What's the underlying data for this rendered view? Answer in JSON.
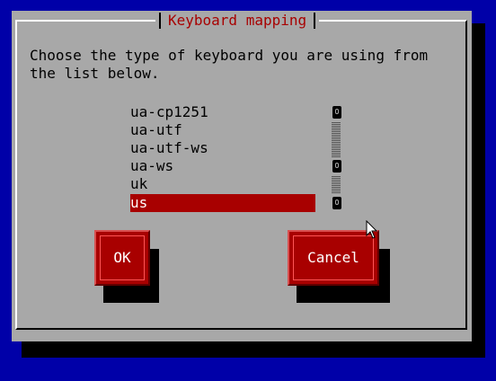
{
  "dialog": {
    "title": "Keyboard mapping",
    "prompt": "Choose the type of keyboard you are using from\nthe list below.",
    "list": {
      "items": [
        "ua-cp1251",
        "ua-utf",
        "ua-utf-ws",
        "ua-ws",
        "uk",
        "us"
      ],
      "selected_index": 5,
      "scrollbar_glyph": "?"
    },
    "buttons": {
      "ok_label": "OK",
      "cancel_label": "Cancel"
    }
  },
  "colors": {
    "screen_background": "#0000a8",
    "dialog_background": "#a8a8a8",
    "accent": "#a80000",
    "highlight_text": "#ffffff"
  }
}
